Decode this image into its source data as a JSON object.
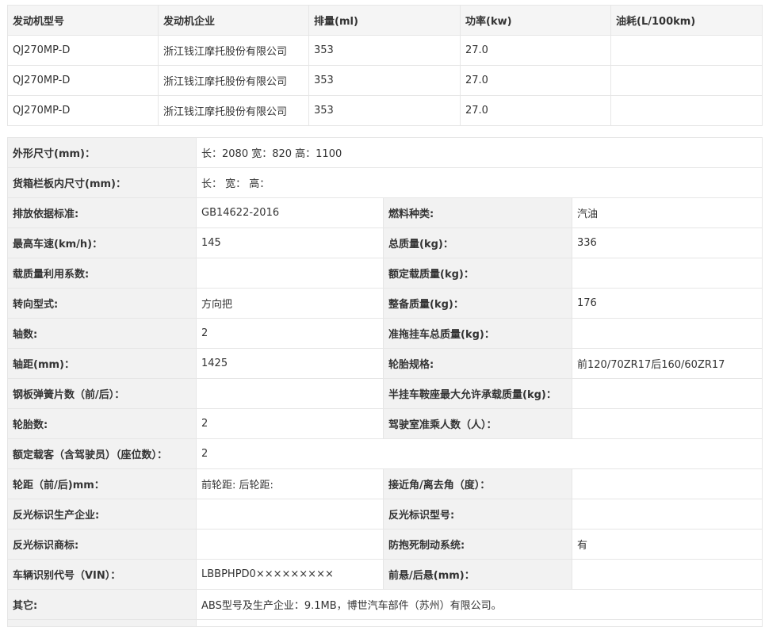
{
  "engine_table": {
    "headers": [
      "发动机型号",
      "发动机企业",
      "排量(ml)",
      "功率(kw)",
      "油耗(L/100km)"
    ],
    "rows": [
      [
        "QJ270MP-D",
        "浙江钱江摩托股份有限公司",
        "353",
        "27.0",
        ""
      ],
      [
        "QJ270MP-D",
        "浙江钱江摩托股份有限公司",
        "353",
        "27.0",
        ""
      ],
      [
        "QJ270MP-D",
        "浙江钱江摩托股份有限公司",
        "353",
        "27.0",
        ""
      ]
    ]
  },
  "spec_table": {
    "outer_dims": {
      "label": "外形尺寸(mm)：",
      "value": "长：2080 宽：820 高：1100"
    },
    "cargo_dims": {
      "label": "货箱栏板内尺寸(mm)：",
      "value": "长： 宽： 高："
    },
    "emission": {
      "label": "排放依据标准:",
      "value": "GB14622-2016"
    },
    "fuel_type": {
      "label": "燃料种类:",
      "value": "汽油"
    },
    "max_speed": {
      "label": "最高车速(km/h)：",
      "value": "145"
    },
    "total_mass": {
      "label": "总质量(kg)：",
      "value": "336"
    },
    "load_util": {
      "label": "载质量利用系数:",
      "value": ""
    },
    "rated_load": {
      "label": "额定载质量(kg)：",
      "value": ""
    },
    "steering": {
      "label": "转向型式:",
      "value": "方向把"
    },
    "curb_mass": {
      "label": "整备质量(kg)：",
      "value": "176"
    },
    "axles": {
      "label": "轴数:",
      "value": "2"
    },
    "trailer_mass": {
      "label": "准拖挂车总质量(kg)：",
      "value": ""
    },
    "wheelbase": {
      "label": "轴距(mm)：",
      "value": "1425"
    },
    "tire_spec": {
      "label": "轮胎规格:",
      "value": "前120/70ZR17后160/60ZR17"
    },
    "leaf_springs": {
      "label": "钢板弹簧片数（前/后）：",
      "value": ""
    },
    "saddle_load": {
      "label": "半挂车鞍座最大允许承载质量(kg)：",
      "value": ""
    },
    "tire_count": {
      "label": "轮胎数:",
      "value": "2"
    },
    "cab_seats": {
      "label": "驾驶室准乘人数（人）：",
      "value": ""
    },
    "passengers": {
      "label": "额定载客（含驾驶员）（座位数）：",
      "value": "2"
    },
    "track": {
      "label": "轮距（前/后)mm：",
      "value": "前轮距: 后轮距:"
    },
    "angles": {
      "label": "接近角/离去角（度）：",
      "value": ""
    },
    "reflector_maker": {
      "label": "反光标识生产企业:",
      "value": ""
    },
    "reflector_model": {
      "label": "反光标识型号:",
      "value": ""
    },
    "reflector_brand": {
      "label": "反光标识商标:",
      "value": ""
    },
    "abs": {
      "label": "防抱死制动系统:",
      "value": "有"
    },
    "vin": {
      "label": "车辆识别代号（VIN）：",
      "value": "LBBPHPD0×××××××××"
    },
    "overhang": {
      "label": "前悬/后悬(mm)：",
      "value": ""
    },
    "other": {
      "label": "其它:",
      "value": "ABS型号及生产企业：9.1MB，博世汽车部件（苏州）有限公司。"
    }
  }
}
